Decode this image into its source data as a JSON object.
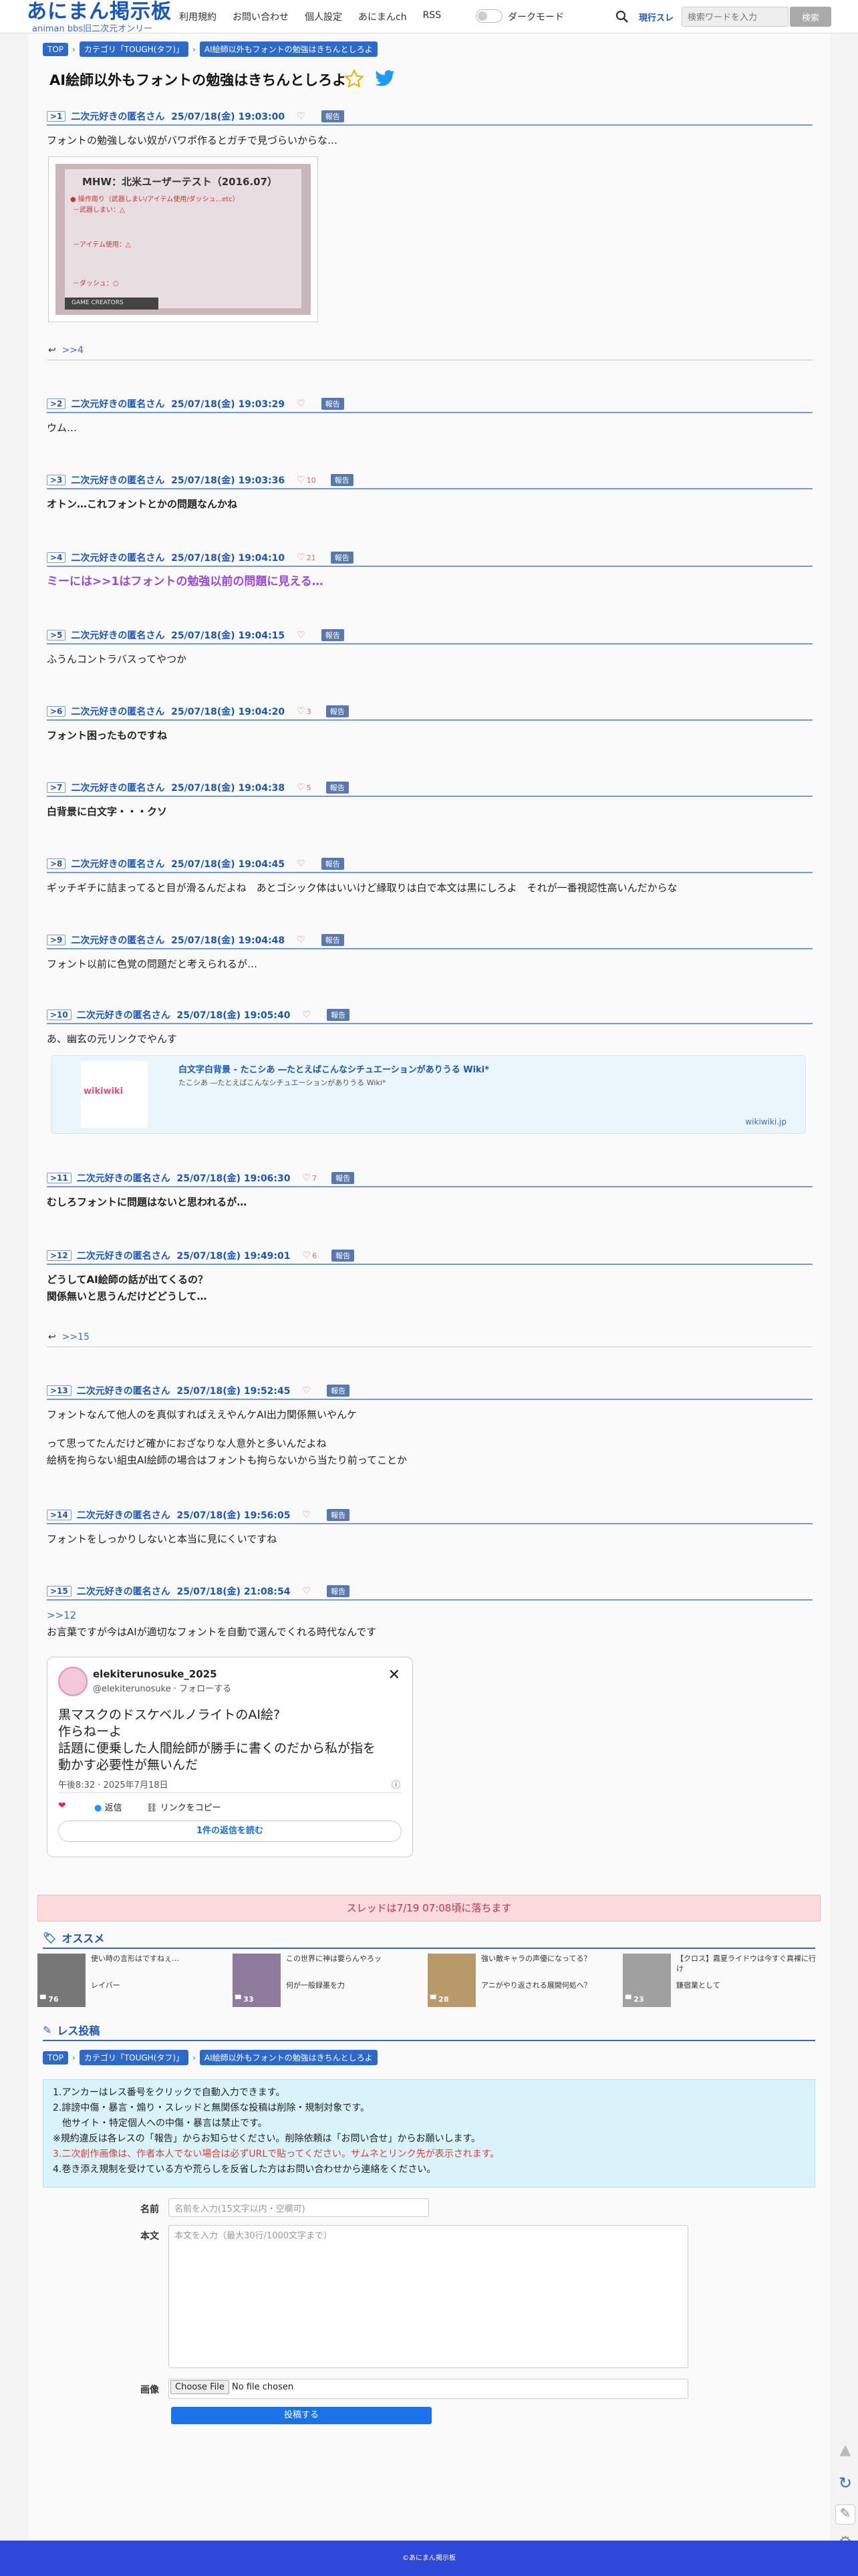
{
  "header": {
    "logo": "あにまん掲示板",
    "sub": "animan bbs旧二次元オンリー",
    "nav": [
      "利用規約",
      "お問い合わせ",
      "個人設定",
      "あにまんch",
      "RSS"
    ],
    "dark_mode": "ダークモード",
    "search_scope": "現行スレ",
    "search_placeholder": "検索ワードを入力",
    "search_btn": "検索"
  },
  "breadcrumb": [
    "TOP",
    "カテゴリ「TOUGH(タフ)」",
    "AI絵師以外もフォントの勉強はきちんとしろよ"
  ],
  "thread_title": "AI絵師以外もフォントの勉強はきちんとしろよ",
  "posts": [
    {
      "num": ">1",
      "name": "二次元好きの匿名さん",
      "date": "25/07/18(金) 19:03:00",
      "likes": "",
      "report": "報告",
      "body": "フォントの勉強しない奴がバワポ作るとガチで見づらいからな…"
    },
    {
      "num": ">2",
      "name": "二次元好きの匿名さん",
      "date": "25/07/18(金) 19:03:29",
      "likes": "",
      "report": "報告",
      "body": "ウム…"
    },
    {
      "num": ">3",
      "name": "二次元好きの匿名さん",
      "date": "25/07/18(金) 19:03:36",
      "likes": "10",
      "report": "報告",
      "body": "オトン…これフォントとかの問題なんかね"
    },
    {
      "num": ">4",
      "name": "二次元好きの匿名さん",
      "date": "25/07/18(金) 19:04:10",
      "likes": "21",
      "report": "報告",
      "body": "ミーには>>1はフォントの勉強以前の問題に見える…"
    },
    {
      "num": ">5",
      "name": "二次元好きの匿名さん",
      "date": "25/07/18(金) 19:04:15",
      "likes": "",
      "report": "報告",
      "body": "ふうんコントラバスってやつか"
    },
    {
      "num": ">6",
      "name": "二次元好きの匿名さん",
      "date": "25/07/18(金) 19:04:20",
      "likes": "3",
      "report": "報告",
      "body": "フォント困ったものですね"
    },
    {
      "num": ">7",
      "name": "二次元好きの匿名さん",
      "date": "25/07/18(金) 19:04:38",
      "likes": "5",
      "report": "報告",
      "body": "白背景に白文字・・・クソ"
    },
    {
      "num": ">8",
      "name": "二次元好きの匿名さん",
      "date": "25/07/18(金) 19:04:45",
      "likes": "",
      "report": "報告",
      "body": "ギッチギチに詰まってると目が滑るんだよね　あとゴシック体はいいけど縁取りは白で本文は黒にしろよ　それが一番視認性高いんだからな"
    },
    {
      "num": ">9",
      "name": "二次元好きの匿名さん",
      "date": "25/07/18(金) 19:04:48",
      "likes": "",
      "report": "報告",
      "body": "フォント以前に色覚の問題だと考えられるが…"
    },
    {
      "num": ">10",
      "name": "二次元好きの匿名さん",
      "date": "25/07/18(金) 19:05:40",
      "likes": "",
      "report": "報告",
      "body": "あ、幽玄の元リンクでやんす"
    },
    {
      "num": ">11",
      "name": "二次元好きの匿名さん",
      "date": "25/07/18(金) 19:06:30",
      "likes": "7",
      "report": "報告",
      "body": "むしろフォントに問題はないと思われるが…"
    },
    {
      "num": ">12",
      "name": "二次元好きの匿名さん",
      "date": "25/07/18(金) 19:49:01",
      "likes": "6",
      "report": "報告",
      "body": "どうしてAI絵師の話が出てくるの？",
      "body2": "関係無いと思うんだけどどうして…"
    },
    {
      "num": ">13",
      "name": "二次元好きの匿名さん",
      "date": "25/07/18(金) 19:52:45",
      "likes": "",
      "report": "報告",
      "body": "フォントなんて他人のを真似すればええやんケAI出力関係無いやんケ",
      "body2": "って思ってたんだけど確かにおざなりな人意外と多いんだよね",
      "body3": "絵柄を拘らない組虫AI絵師の場合はフォントも拘らないから当たり前ってことか"
    },
    {
      "num": ">14",
      "name": "二次元好きの匿名さん",
      "date": "25/07/18(金) 19:56:05",
      "likes": "",
      "report": "報告",
      "body": "フォントをしっかりしないと本当に見にくいですね"
    },
    {
      "num": ">15",
      "name": "二次元好きの匿名さん",
      "date": "25/07/18(金) 21:08:54",
      "likes": "",
      "report": "報告",
      "anchor": ">>12",
      "body": "お言葉ですが今はAIが適切なフォントを自動で選んでくれる時代なんです"
    }
  ],
  "img1": {
    "title": "MHW：北米ユーザーテスト（2016.07）",
    "l1": "● 操作周り（武器しまい/アイテム使用/ダッシュ...etc）",
    "l2": "－武器しまい：△",
    "l3": "－アイテム使用：△",
    "l4": "－ダッシュ：○",
    "l5": "GAME CREATORS"
  },
  "reply1": ">>4",
  "reply2": ">>15",
  "card": {
    "title": "白文字白背景 - たこシあ ―たとえばこんなシチュエーションがありうる Wiki*",
    "desc": "たこシあ ―たとえばこんなシチュエーションがありうる Wiki*",
    "site": "wikiwiki.jp",
    "thumb": "wikiwiki"
  },
  "tweet": {
    "name": "elekiterunosuke_2025",
    "handle": "@elekiterunosuke · フォローする",
    "line1": "黒マスクのドスケベルノライトのAI絵?",
    "line2": "作らねーよ",
    "line3": "話題に便乗した人間絵師が勝手に書くのだから私が指を",
    "line4": "動かす必要性が無いんだ",
    "time": "午後8:32 · 2025年7月18日",
    "reply": "返信",
    "copy": "リンクをコピー",
    "more": "1件の返信を読む"
  },
  "notice": "スレッドは7/19 07:08頃に落ちます",
  "recommend": {
    "title": "オススメ",
    "items": [
      {
        "t": "使い時の言形はですねぇ…",
        "t2": "レイバー",
        "count": "76"
      },
      {
        "t": "この世界に神は要らんやろッ",
        "t2": "何が一般録墨を力",
        "count": "33"
      },
      {
        "t": "強い敵キャラの声優になってる？",
        "t2": "アニがやり返される展開何処へ？",
        "count": "28"
      },
      {
        "t": "【クロス】霧夏ライドウは今すぐ真裸に行け",
        "t2": "鎌宿業として",
        "count": "23"
      }
    ]
  },
  "form": {
    "title": "レス投稿",
    "name_label": "名前",
    "name_ph": "名前を入力(15文字以内・空欄可)",
    "body_label": "本文",
    "body_ph": "本文を入力（最大30行/1000文字まで）",
    "image_label": "画像",
    "file_btn": "Choose File",
    "file_none": "No file chosen",
    "submit": "投稿する"
  },
  "rules": {
    "r1": "1.アンカーはレス番号をクリックで自動入力できます。",
    "r2": "2.誹謗中傷・暴言・煽り・スレッドと無関係な投稿は削除・規制対象です。",
    "r3": "　他サイト・特定個人への中傷・暴言は禁止です。",
    "r4": "※規約違反は各レスの「報告」からお知らせください。削除依頼は「お問い合せ」からお願いします。",
    "r5": "3.二次創作画像は、作者本人でない場合は必ずURLで貼ってください。サムネとリンク先が表示されます。",
    "r6": "4.巻き添え規制を受けている方や荒らしを反省した方はお問い合わせから連絡をください。"
  },
  "footer": "©あにまん掲示板"
}
